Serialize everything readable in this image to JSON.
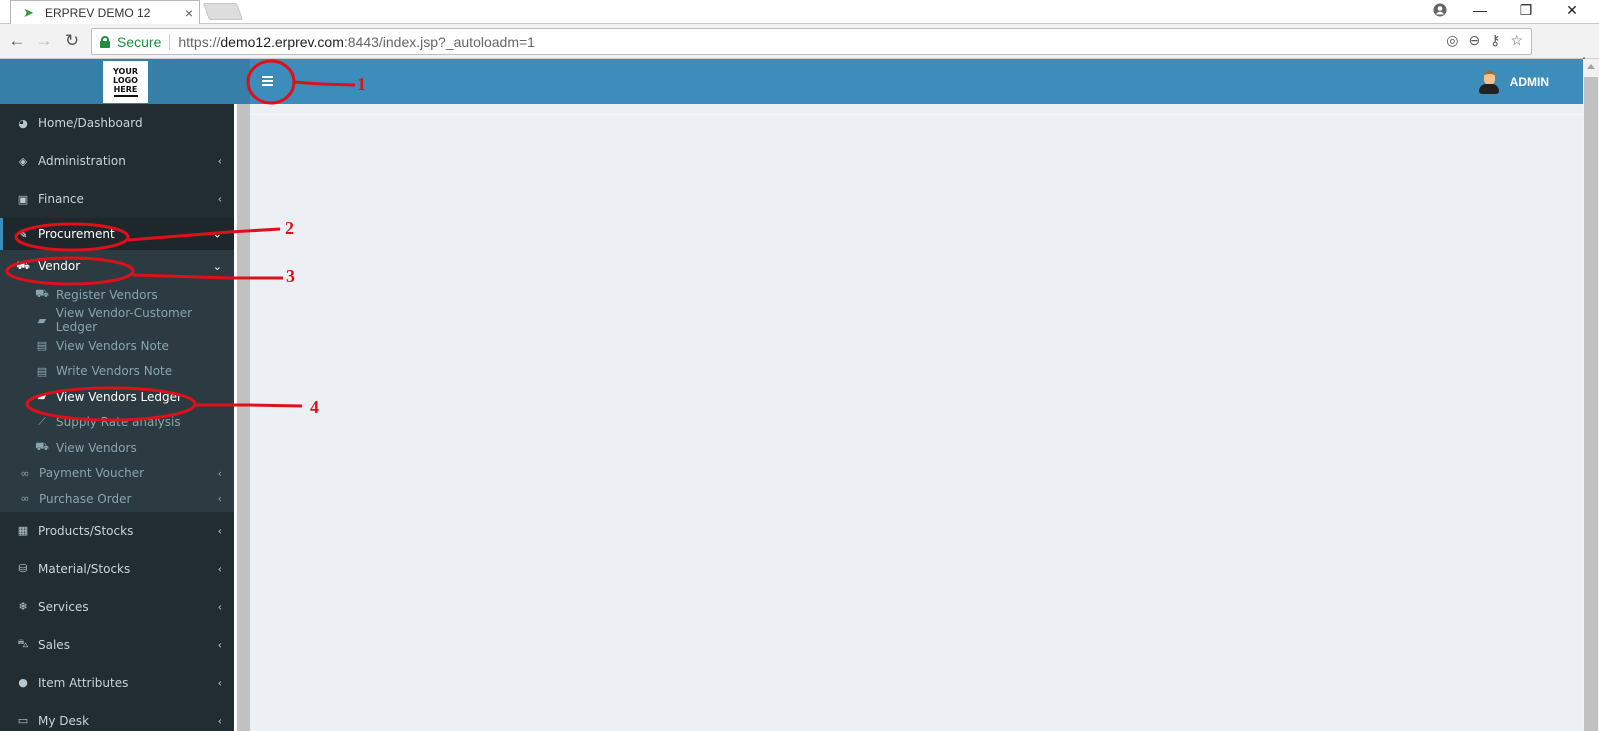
{
  "browser": {
    "tab_title": "ERPREV DEMO 12",
    "tab_close": "×",
    "secure_label": "Secure",
    "url_scheme": "https://",
    "url_host": "demo12.erprev.com",
    "url_rest": ":8443/index.jsp?_autoloadm=1",
    "window_controls": {
      "minimize": "—",
      "maximize": "❐",
      "close": "✕"
    }
  },
  "header": {
    "logo_lines": [
      "YOUR",
      "LOGO",
      "HERE"
    ],
    "user_name": "ADMIN",
    "accent_color": "#3c8dbc"
  },
  "sidebar": {
    "items": [
      {
        "label": "Home/Dashboard",
        "icon": "dashboard-icon",
        "chevron": ""
      },
      {
        "label": "Administration",
        "icon": "ticket-icon",
        "chevron": "‹"
      },
      {
        "label": "Finance",
        "icon": "money-icon",
        "chevron": "‹"
      },
      {
        "label": "Procurement",
        "icon": "procurement-icon",
        "chevron": "⌄",
        "active": true
      }
    ],
    "procurement_children": {
      "vendor": {
        "label": "Vendor",
        "icon": "bus-icon",
        "chevron": "⌄"
      },
      "vendor_children": [
        {
          "label": "Register Vendors",
          "icon": "bus-icon"
        },
        {
          "label": "View Vendor-Customer Ledger",
          "icon": "book-icon"
        },
        {
          "label": "View Vendors Note",
          "icon": "file-text-icon"
        },
        {
          "label": "Write Vendors Note",
          "icon": "file-text-icon"
        },
        {
          "label": "View Vendors Ledger",
          "icon": "book-icon",
          "current": true
        },
        {
          "label": "Supply Rate analysis",
          "icon": "line-chart-icon"
        },
        {
          "label": "View Vendors",
          "icon": "bus-icon"
        }
      ],
      "others": [
        {
          "label": "Payment Voucher",
          "icon": "link-icon",
          "chevron": "‹"
        },
        {
          "label": "Purchase Order",
          "icon": "link-icon",
          "chevron": "‹"
        }
      ]
    },
    "items_after": [
      {
        "label": "Products/Stocks",
        "icon": "building-icon",
        "chevron": "‹"
      },
      {
        "label": "Material/Stocks",
        "icon": "bucket-icon",
        "chevron": "‹"
      },
      {
        "label": "Services",
        "icon": "snowflake-icon",
        "chevron": "‹"
      },
      {
        "label": "Sales",
        "icon": "cart-icon",
        "chevron": "‹"
      },
      {
        "label": "Item Attributes",
        "icon": "spotify-icon",
        "chevron": "‹"
      },
      {
        "label": "My Desk",
        "icon": "desktop-icon",
        "chevron": "‹"
      }
    ]
  },
  "annotations": {
    "labels": [
      "1",
      "2",
      "3",
      "4"
    ],
    "color": "#e0101a"
  }
}
